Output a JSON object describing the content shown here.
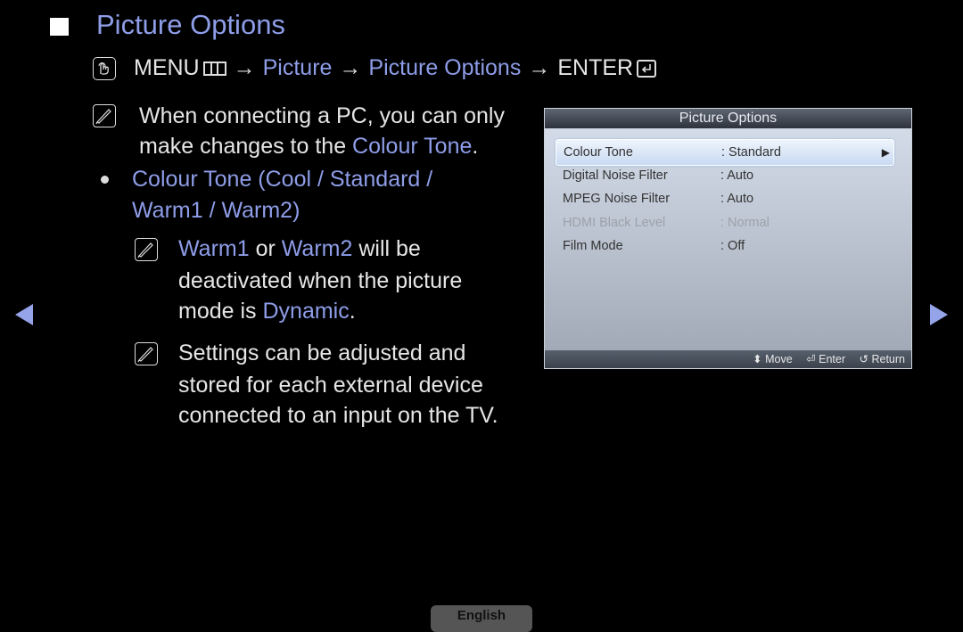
{
  "header": {
    "title": "Picture Options",
    "path": {
      "menu": "MENU",
      "arrow": "→",
      "step1": "Picture",
      "step2": "Picture Options",
      "enter": "ENTER"
    }
  },
  "body": {
    "note1": {
      "line1": "When connecting a PC, you can only",
      "line2_prefix": "make changes to the ",
      "line2_highlight": "Colour Tone",
      "line2_suffix": "."
    },
    "bullet": {
      "line1": "Colour Tone (Cool / Standard /",
      "line2": "Warm1 / Warm2)"
    },
    "note2": {
      "w1": "Warm1",
      "or": " or ",
      "w2": "Warm2",
      "suffix": " will be",
      "line2": "deactivated when the picture",
      "line3_prefix": "mode is ",
      "line3_highlight": "Dynamic",
      "line3_suffix": "."
    },
    "note3": {
      "line1": "Settings can be adjusted and",
      "line2": "stored for each external device",
      "line3": "connected to an input on the TV."
    }
  },
  "osd": {
    "title": "Picture Options",
    "rows": [
      {
        "label": "Colour Tone",
        "value": ": Standard",
        "selected": true
      },
      {
        "label": "Digital Noise Filter",
        "value": ": Auto"
      },
      {
        "label": "MPEG Noise Filter",
        "value": ": Auto"
      },
      {
        "label": "HDMI Black Level",
        "value": ": Normal",
        "disabled": true
      },
      {
        "label": "Film Mode",
        "value": ": Off"
      }
    ],
    "footer": {
      "move": "Move",
      "enter": "Enter",
      "return": "Return"
    }
  },
  "language_button": "English",
  "colors": {
    "accent": "#8e9de8",
    "text": "#e6e6e6",
    "background": "#000000"
  }
}
